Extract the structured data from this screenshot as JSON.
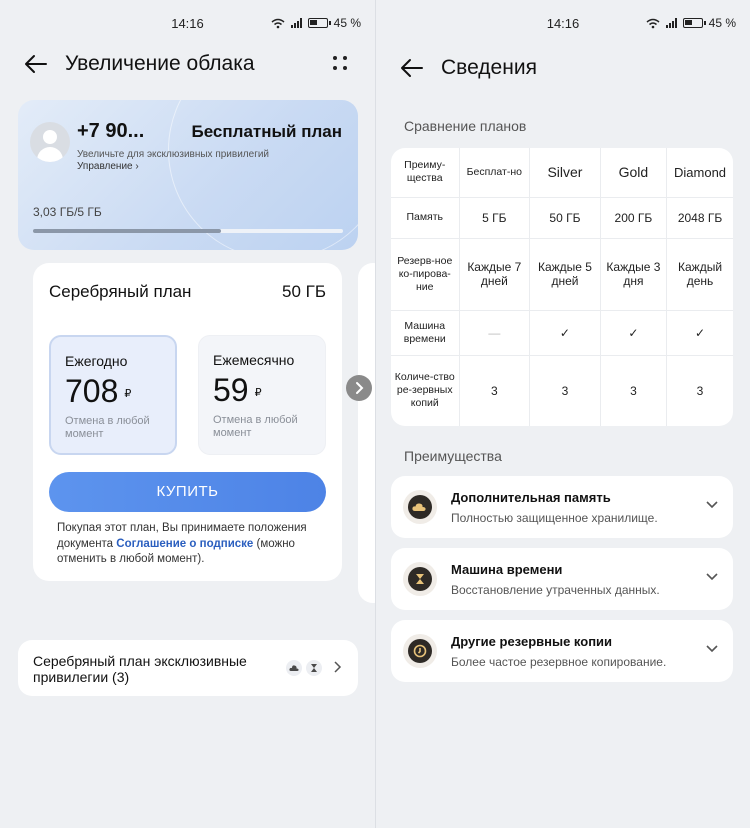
{
  "status": {
    "time": "14:16",
    "battery": "45 %"
  },
  "left": {
    "header": {
      "title": "Увеличение облака"
    },
    "account": {
      "phone": "+7 90...",
      "plan": "Бесплатный план",
      "subtitle": "Увеличьте для эксклюзивных привилегий",
      "manage": "Управление",
      "storage_text": "3,03 ГБ/5 ГБ",
      "storage_fraction": 0.606
    },
    "plan_card": {
      "title": "Серебряный план",
      "size": "50 ГБ",
      "yearly": {
        "label": "Ежегодно",
        "price": "708",
        "currency": "₽",
        "note": "Отмена в любой момент"
      },
      "monthly": {
        "label": "Ежемесячно",
        "price": "59",
        "currency": "₽",
        "note": "Отмена в любой момент"
      },
      "buy": "КУПИТЬ",
      "terms_before": "Покупая этот план, Вы принимаете положения документа ",
      "terms_link": "Соглашение о подписке",
      "terms_after": " (можно отменить в любой момент)."
    },
    "privileges": {
      "text": "Серебряный план эксклюзивные привилегии (3)"
    }
  },
  "right": {
    "header": {
      "title": "Сведения"
    },
    "compare_title": "Сравнение планов",
    "table": {
      "header": [
        "Преиму-щества",
        "Бесплат-но",
        "Silver",
        "Gold",
        "Diamond"
      ],
      "rows": [
        [
          "Память",
          "5 ГБ",
          "50 ГБ",
          "200 ГБ",
          "2048 ГБ"
        ],
        [
          "Резерв-ное ко-пирова-ние",
          "Каждые 7 дней",
          "Каждые 5 дней",
          "Каждые 3 дня",
          "Каждый день"
        ],
        [
          "Машина времени",
          "—",
          "✓",
          "✓",
          "✓"
        ],
        [
          "Количе-ство ре-зервных копий",
          "3",
          "3",
          "3",
          "3"
        ]
      ]
    },
    "benefits_title": "Преимущества",
    "benefits": [
      {
        "title": "Дополнительная память",
        "desc": "Полностью защищенное хранилище.",
        "icon": "cloud-icon"
      },
      {
        "title": "Машина времени",
        "desc": "Восстановление утраченных данных.",
        "icon": "hourglass-icon"
      },
      {
        "title": "Другие резервные копии",
        "desc": "Более частое резервное копирование.",
        "icon": "backup-icon"
      }
    ]
  }
}
